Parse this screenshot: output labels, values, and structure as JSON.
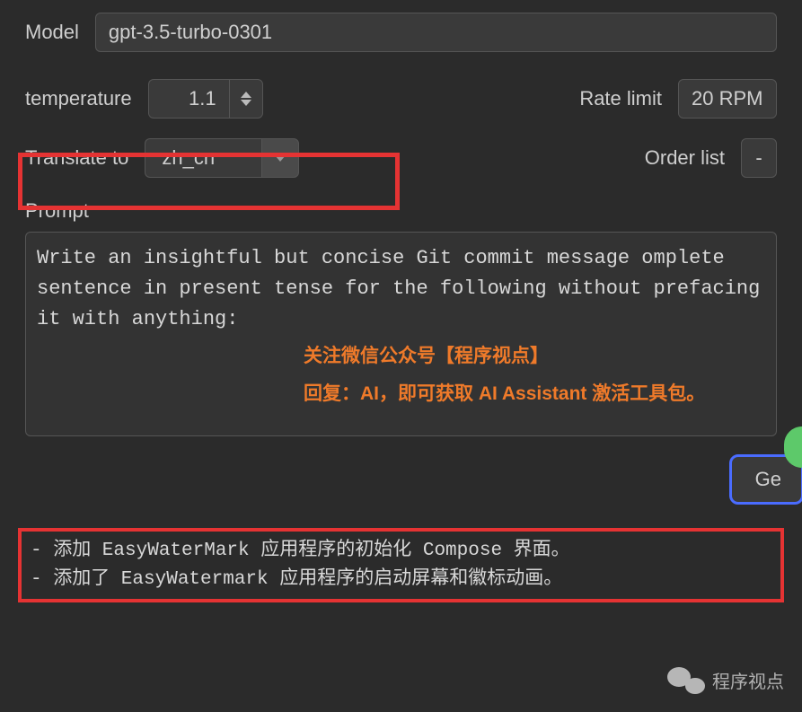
{
  "model": {
    "label": "Model",
    "value": "gpt-3.5-turbo-0301"
  },
  "temperature": {
    "label": "temperature",
    "value": "1.1"
  },
  "rate_limit": {
    "label": "Rate limit",
    "value": "20 RPM"
  },
  "translate": {
    "label": "Translate to",
    "value": "zh_cn"
  },
  "order_list": {
    "label": "Order list",
    "value": "-"
  },
  "prompt": {
    "label": "Prompt",
    "text": "Write an insightful but concise Git commit message omplete sentence in present tense for the following without prefacing it with anything:"
  },
  "overlay": {
    "line1": "关注微信公众号【程序视点】",
    "line2": "回复：AI，即可获取 AI Assistant 激活工具包。"
  },
  "generate_button": "Ge",
  "output": {
    "line1": "- 添加 EasyWaterMark 应用程序的初始化 Compose 界面。",
    "line2": "- 添加了 EasyWatermark 应用程序的启动屏幕和徽标动画。"
  },
  "watermark": "程序视点"
}
